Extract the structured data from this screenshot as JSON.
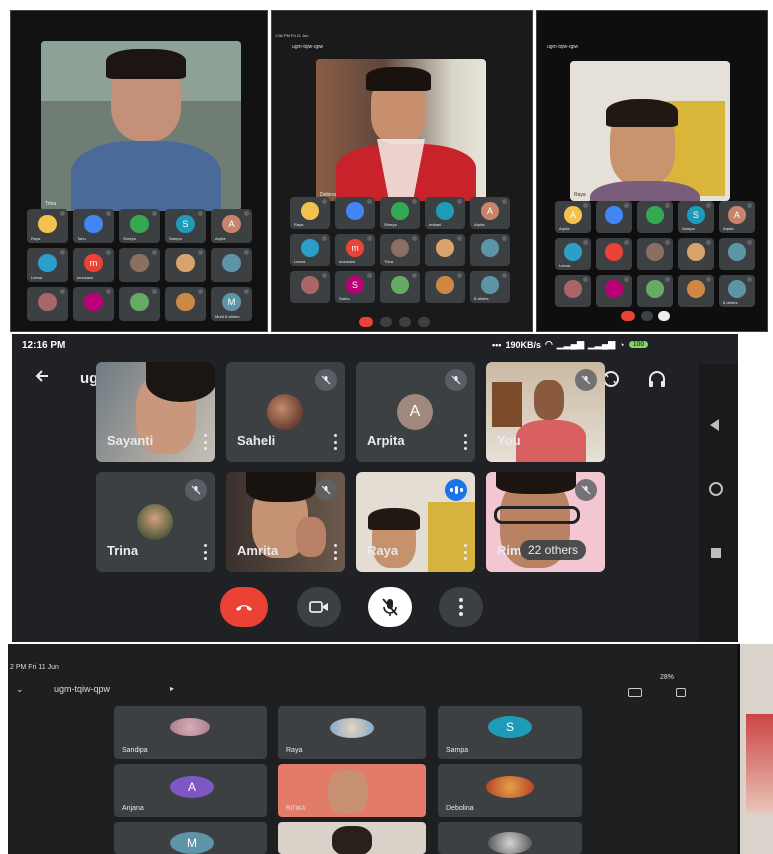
{
  "panel_a": {
    "pin_name": "Trina",
    "tiles": [
      "Raya",
      "Tanu",
      "Shreya",
      "Sampa",
      "Arpita",
      "Leena",
      "mousumi",
      "",
      "",
      "",
      "",
      "",
      "",
      "",
      "Murti 8 others"
    ],
    "tile_letters": {
      "sampa": "S",
      "arpita": "A",
      "mousumi": "m",
      "murti": "M"
    }
  },
  "panel_b": {
    "status_left": "1:56 PM  Fri 11 Jun",
    "meeting": "ugm-tqiw-qpw",
    "pin_name": "Debina",
    "tiles": [
      "Raya",
      "",
      "Shreya",
      "Indrani",
      "Arpita",
      "Leena",
      "mousumi",
      "Trina",
      "",
      "",
      "",
      "Sarbo",
      "",
      "",
      "8 others"
    ],
    "tile_letters": {
      "arpita": "A",
      "mousumi": "m",
      "sarbo": "S"
    }
  },
  "panel_c": {
    "meeting": "ugm-tqiw-qpw",
    "pin_name": "Raya",
    "tiles": [
      "Arpita",
      "",
      "",
      "Sampa",
      "Arpita",
      "Leena",
      "",
      "",
      "",
      "",
      "",
      "",
      "",
      "",
      "8 others"
    ],
    "tile_letters": {
      "sampa": "S",
      "arpita": "A"
    }
  },
  "main": {
    "time": "12:16 PM",
    "net": "190KB/s",
    "battery": "100",
    "meeting": "ugm-tqiw-qpw",
    "meeting_chevron": "▸",
    "tiles": {
      "sayanti": "Sayanti",
      "saheli": "Saheli",
      "arpita": "Arpita",
      "arpita_letter": "A",
      "you": "You",
      "trina": "Trina",
      "amrita": "Amrita",
      "raya": "Raya",
      "rim": "Rim",
      "others": "22 others"
    }
  },
  "panel_d": {
    "status_left": "2 PM   Fri 11 Jun",
    "battery": "28%",
    "meeting": "ugm-tqiw-qpw",
    "meeting_chevron": "▸",
    "tiles": [
      "Sandipa",
      "Raya",
      "Sampa",
      "Anjana",
      "RITIKA",
      "Debolina"
    ],
    "tile_letters": {
      "sampa": "S",
      "anjana": "A",
      "m": "M"
    }
  },
  "colors": {
    "end_call": "#ea4335",
    "meet_bg": "#202124",
    "tile_bg": "#3c4043",
    "accent_blue": "#1a73e8"
  }
}
